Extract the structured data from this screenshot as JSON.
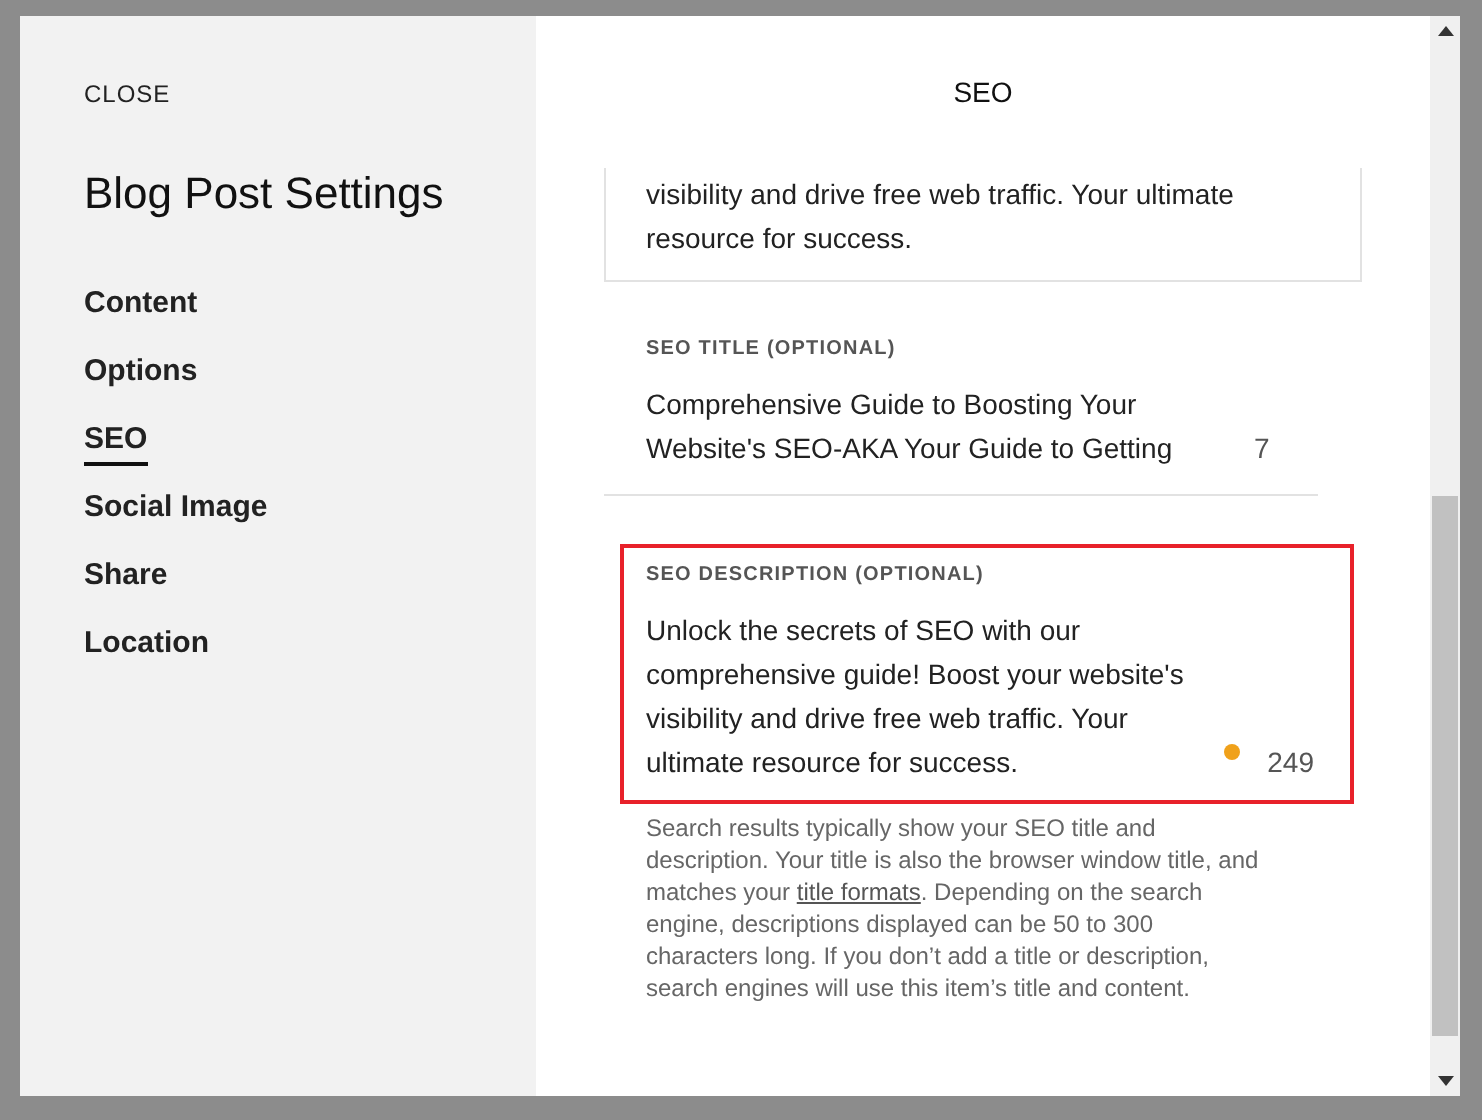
{
  "sidebar": {
    "close": "CLOSE",
    "title": "Blog Post Settings",
    "items": [
      {
        "label": "Content",
        "selected": false
      },
      {
        "label": "Options",
        "selected": false
      },
      {
        "label": "SEO",
        "selected": true
      },
      {
        "label": "Social Image",
        "selected": false
      },
      {
        "label": "Share",
        "selected": false
      },
      {
        "label": "Location",
        "selected": false
      }
    ]
  },
  "panel": {
    "title": "SEO",
    "excerpt_field": {
      "value_lines": [
        "visibility and drive free web traffic. Your ultimate",
        "resource for success."
      ]
    },
    "fields": [
      {
        "label": "SEO TITLE (OPTIONAL)",
        "value": "Comprehensive Guide to Boosting Your Website's SEO-AKA Your Guide to Getting",
        "count": "7",
        "highlighted": false,
        "warning": false
      },
      {
        "label": "SEO DESCRIPTION (OPTIONAL)",
        "value": "Unlock the secrets of SEO with our comprehensive guide! Boost your website's visibility and drive free web traffic. Your ultimate resource for success.",
        "count": "249",
        "highlighted": true,
        "warning": true
      }
    ],
    "help": {
      "before": "Search results typically show your SEO title and description. Your title is also the browser window title, and matches your ",
      "link": "title formats",
      "after": ". Depending on the search engine, descriptions displayed can be 50 to 300 characters long. If you don’t add a title or description, search engines will use this item’s title and content."
    }
  }
}
